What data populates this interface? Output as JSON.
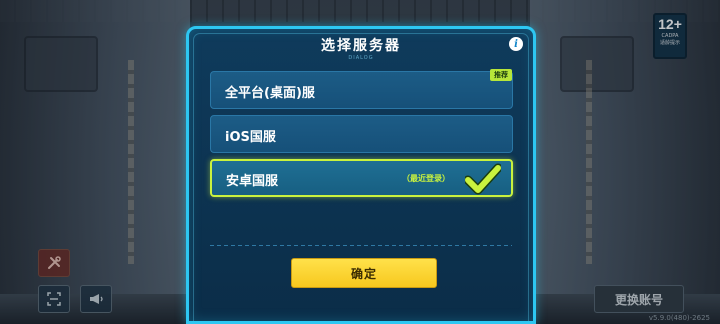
{
  "dialog": {
    "title": "选择服务器",
    "subtitle": "DIALOG",
    "info_icon": "i",
    "servers": [
      {
        "label": "全平台(桌面)服",
        "tag": "推荐",
        "selected": false
      },
      {
        "label": "iOS国服",
        "tag": "",
        "selected": false
      },
      {
        "label": "安卓国服",
        "tag": "（最近登录）",
        "selected": true
      }
    ],
    "confirm_label": "确定"
  },
  "age_rating": {
    "number": "12+",
    "caption": "CADPA",
    "note": "适龄提示"
  },
  "switch_account_label": "更换账号",
  "version": "v5.9.0(480)-2625",
  "icons": {
    "tools": "tools-icon",
    "scan": "scan-icon",
    "notice": "megaphone-icon",
    "check": "check-icon",
    "info": "info-icon"
  },
  "colors": {
    "dialog_border": "#2dc7f2",
    "selected_border": "#c9f23e",
    "confirm_button": "#f7c81e",
    "recommend_tag": "#b7e63a"
  }
}
